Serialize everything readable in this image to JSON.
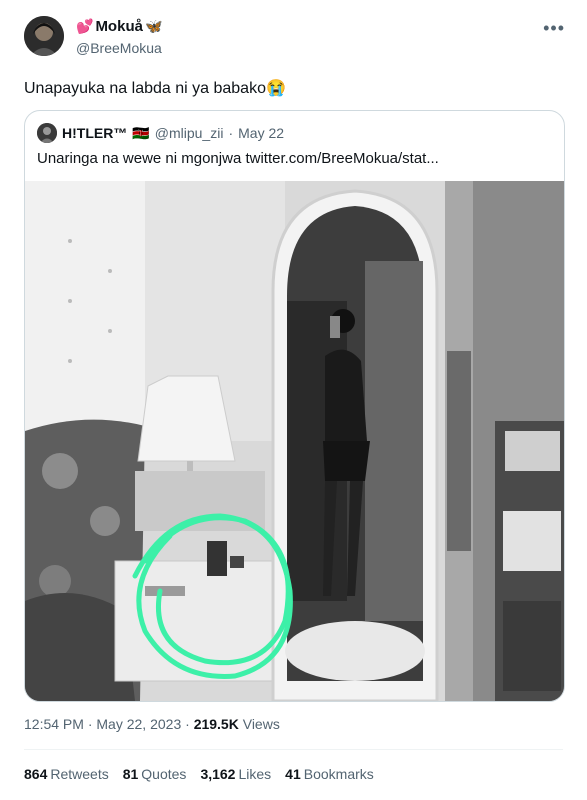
{
  "author": {
    "display_name": "Mokuå",
    "handle": "@BreeMokua",
    "name_prefix": "💕",
    "name_suffix": "🦋"
  },
  "tweet": {
    "text": "Unapayuka na labda ni ya babako",
    "emoji": "😭"
  },
  "quote": {
    "display_name": "H!TLER™",
    "flag": "🇰🇪",
    "handle": "@mlipu_zii",
    "separator": "·",
    "date": "May 22",
    "text": "Unaringa na wewe ni mgonjwa  twitter.com/BreeMokua/stat..."
  },
  "meta": {
    "time": "12:54 PM",
    "separator": "·",
    "date": "May 22, 2023",
    "views_count": "219.5K",
    "views_label": "Views"
  },
  "stats": [
    {
      "count": "864",
      "label": "Retweets"
    },
    {
      "count": "81",
      "label": "Quotes"
    },
    {
      "count": "3,162",
      "label": "Likes"
    },
    {
      "count": "41",
      "label": "Bookmarks"
    }
  ],
  "icons": {
    "more": "more-options-icon"
  },
  "colors": {
    "highlight_circle": "#3df0a8",
    "secondary_text": "#536471",
    "border": "#cfd9de"
  }
}
